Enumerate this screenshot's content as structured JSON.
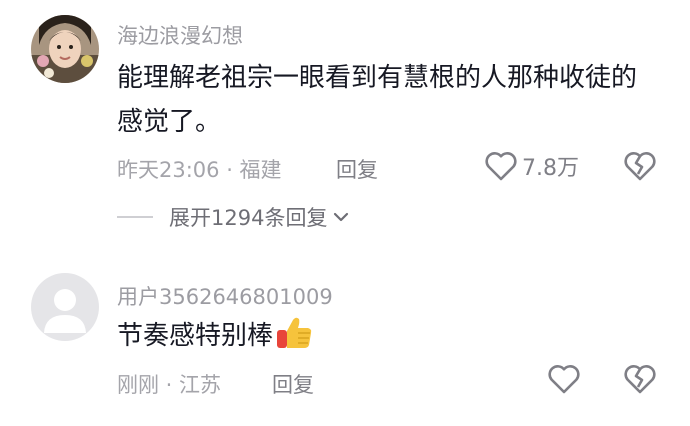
{
  "comments": [
    {
      "username": "海边浪漫幻想",
      "text": "能理解老祖宗一眼看到有慧根的人那种收徒的感觉了。",
      "meta": "昨天23:06 · 福建",
      "reply_label": "回复",
      "like_count": "7.8万",
      "expand_label": "展开1294条回复",
      "avatar_icon": "user-photo"
    },
    {
      "username": "用户3562646801009",
      "text": "节奏感特别棒",
      "emoji": "thumbs-up-emoji",
      "meta": "刚刚 · 江苏",
      "reply_label": "回复",
      "like_count": "",
      "avatar_icon": "default-avatar-icon"
    }
  ],
  "icons": {
    "like": "heart-outline-icon",
    "dislike": "broken-heart-icon",
    "expand": "chevron-down-icon"
  },
  "colors": {
    "primary_text": "#161823",
    "secondary_text": "#9c9ca2",
    "icon": "#7f7f86"
  }
}
